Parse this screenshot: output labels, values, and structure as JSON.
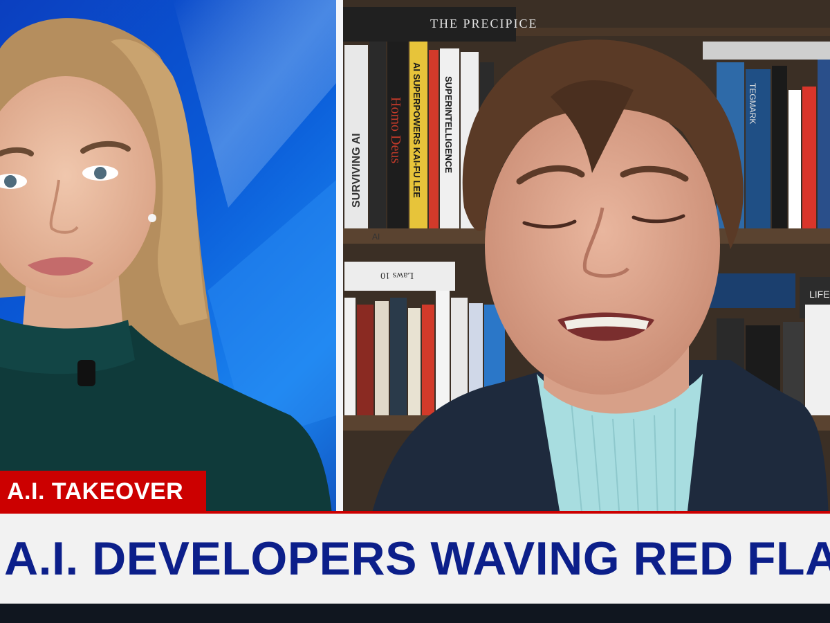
{
  "broadcast": {
    "topic_tag": "A.I. TAKEOVER",
    "headline": "A.I. DEVELOPERS WAVING RED FLAGS"
  },
  "book_spines": [
    "THE PRECIPICE",
    "SURVIVING AI",
    "Homo Deus",
    "AI SUPERPOWERS KAI-FU LEE",
    "SUPERINTELLIGENCE",
    "TEGMARK",
    "Laws 10",
    "AI",
    "LIFE"
  ],
  "colors": {
    "tag_red": "#cc0000",
    "headline_blue": "#0c1f8a",
    "headline_bg": "#f2f2f2",
    "studio_blue": "#0a5bd8"
  }
}
